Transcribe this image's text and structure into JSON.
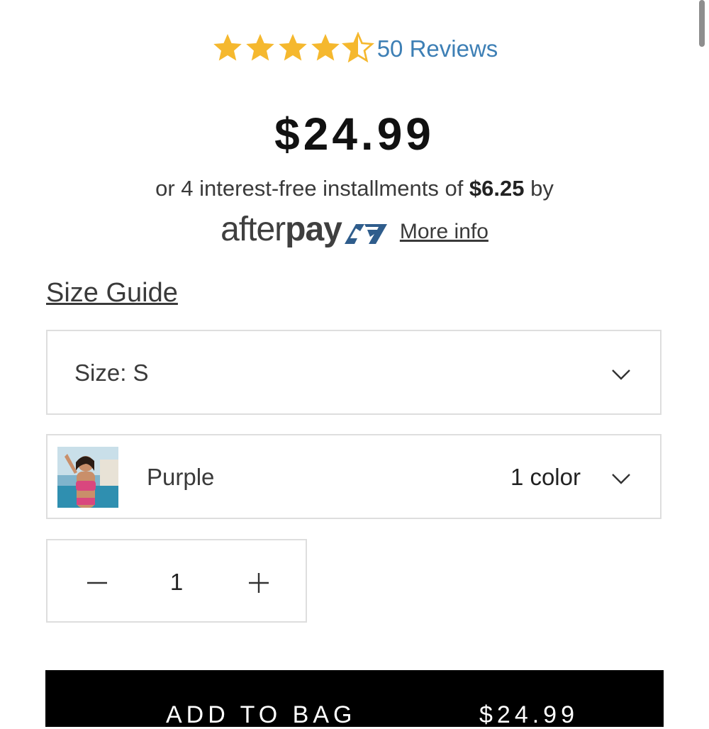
{
  "rating": {
    "value": 4.5,
    "max": 5,
    "star_color": "#f5b82e",
    "reviews_label": "50 Reviews"
  },
  "price": "$24.99",
  "installments": {
    "prefix": "or 4 interest-free installments of ",
    "amount": "$6.25",
    "suffix": " by"
  },
  "afterpay": {
    "logo_light": "after",
    "logo_bold": "pay",
    "logo_icon": "afterpay-arrows-icon",
    "more_info_label": "More info",
    "brand_color": "#3f3f3f"
  },
  "size_guide_label": "Size Guide",
  "size_select": {
    "label": "Size: S",
    "icon": "chevron-down-icon"
  },
  "color_select": {
    "name": "Purple",
    "count_label": "1 color",
    "icon": "chevron-down-icon"
  },
  "quantity": {
    "value": "1",
    "minus_icon": "minus-icon",
    "plus_icon": "plus-icon"
  },
  "add_to_bag": {
    "label": "ADD TO BAG",
    "price": "$24.99",
    "background": "#000000"
  }
}
